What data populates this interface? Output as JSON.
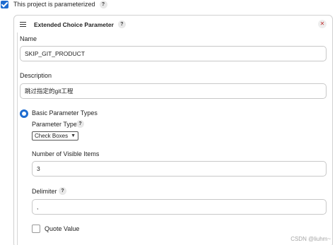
{
  "parameterized": {
    "label": "This project is parameterized",
    "checked": true,
    "help": "?"
  },
  "panel": {
    "title": "Extended Choice Parameter",
    "help": "?",
    "close": "✕"
  },
  "name": {
    "label": "Name",
    "value": "SKIP_GIT_PRODUCT"
  },
  "description": {
    "label": "Description",
    "value": "跳过指定的git工程"
  },
  "basic_types": {
    "label": "Basic Parameter Types",
    "selected": true
  },
  "parameter_type": {
    "label": "Parameter Type",
    "help": "?",
    "selected": "Check Boxes"
  },
  "visible_items": {
    "label": "Number of Visible Items",
    "value": "3"
  },
  "delimiter": {
    "label": "Delimiter",
    "help": "?",
    "value": ","
  },
  "quote_value": {
    "label": "Quote Value",
    "checked": false
  },
  "watermark": "CSDN @liuhm~",
  "colors": {
    "accent": "#1e6cd0",
    "close": "#c03030",
    "border": "#c8c8c8"
  }
}
